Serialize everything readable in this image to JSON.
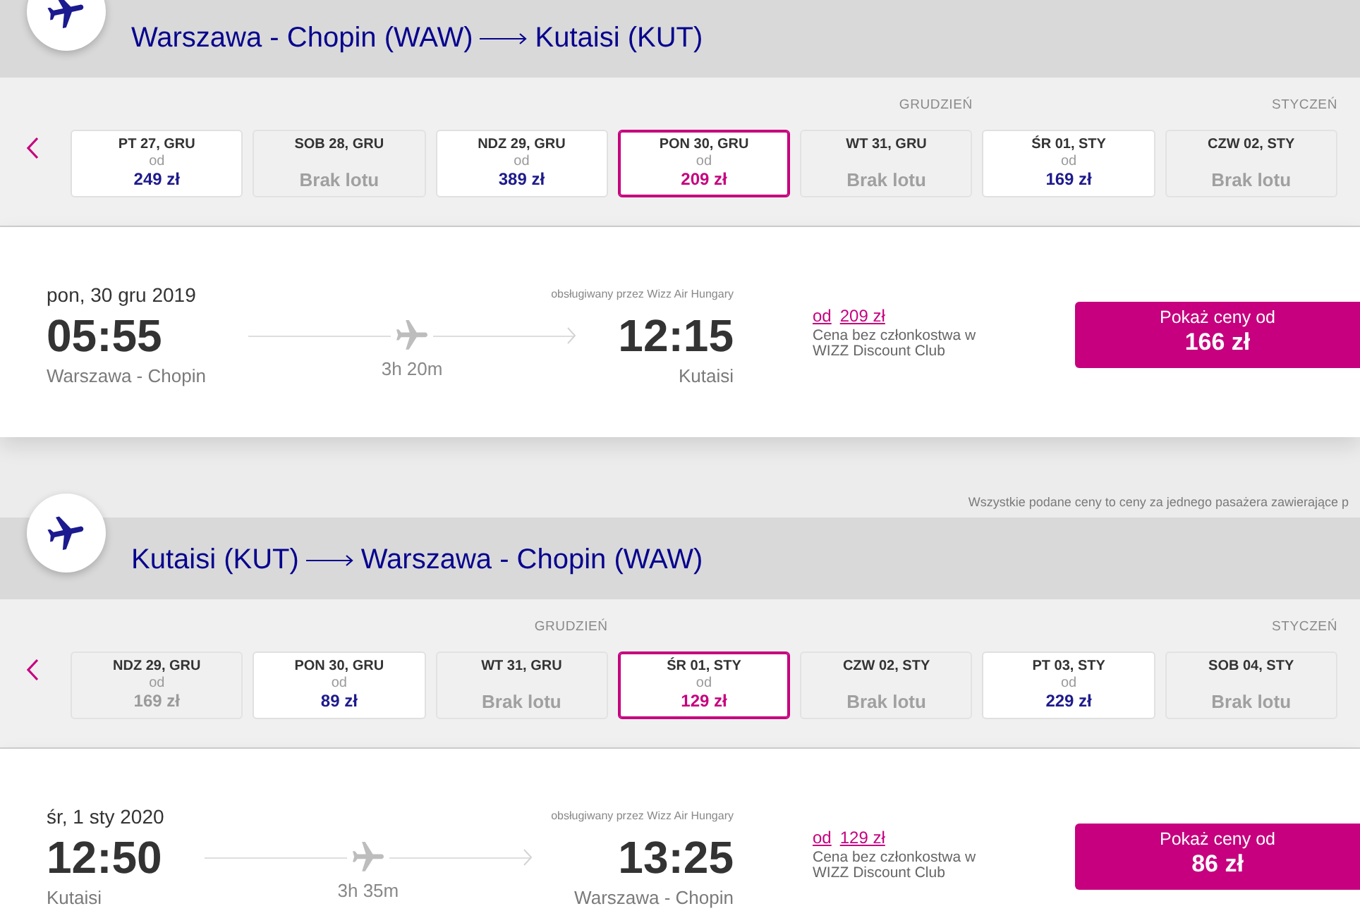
{
  "sections": [
    {
      "route": {
        "origin": "Warszawa - Chopin (WAW)",
        "destination": "Kutaisi (KUT)"
      },
      "months": [
        {
          "label": "GRUDZIEŃ",
          "days": [
            {
              "date": "PT 27, GRU",
              "from": "od",
              "price": "249 zł",
              "available": true,
              "selected": false
            },
            {
              "date": "SOB 28, GRU",
              "price": "Brak lotu",
              "available": false,
              "selected": false
            },
            {
              "date": "NDZ 29, GRU",
              "from": "od",
              "price": "389 zł",
              "available": true,
              "selected": false
            },
            {
              "date": "PON 30, GRU",
              "from": "od",
              "price": "209 zł",
              "available": true,
              "selected": true
            },
            {
              "date": "WT 31, GRU",
              "price": "Brak lotu",
              "available": false,
              "selected": false
            }
          ]
        },
        {
          "label": "STYCZEŃ",
          "days": [
            {
              "date": "ŚR 01, STY",
              "from": "od",
              "price": "169 zł",
              "available": true,
              "selected": false
            },
            {
              "date": "CZW 02, STY",
              "price": "Brak lotu",
              "available": false,
              "selected": false
            }
          ]
        }
      ],
      "flight": {
        "date": "pon, 30 gru 2019",
        "departure_time": "05:55",
        "departure_airport": "Warszawa - Chopin",
        "duration": "3h 20m",
        "operator": "obsługiwany przez Wizz Air Hungary",
        "arrival_time": "12:15",
        "arrival_airport": "Kutaisi",
        "regular_price": {
          "prefix": "od",
          "price": "209 zł"
        },
        "price_note": "Cena bez członkostwa w WIZZ Discount Club",
        "button": {
          "label": "Pokaż ceny od",
          "price": "166 zł"
        }
      }
    },
    {
      "notice": "Wszystkie podane ceny to ceny za jednego pasażera zawierające p",
      "route": {
        "origin": "Kutaisi (KUT)",
        "destination": "Warszawa - Chopin (WAW)"
      },
      "months": [
        {
          "label": "GRUDZIEŃ",
          "days": [
            {
              "date": "NDZ 29, GRU",
              "from": "od",
              "price": "169 zł",
              "available": false,
              "selected": false
            },
            {
              "date": "PON 30, GRU",
              "from": "od",
              "price": "89 zł",
              "available": true,
              "selected": false
            },
            {
              "date": "WT 31, GRU",
              "price": "Brak lotu",
              "available": false,
              "selected": false
            }
          ]
        },
        {
          "label": "STYCZEŃ",
          "days": [
            {
              "date": "ŚR 01, STY",
              "from": "od",
              "price": "129 zł",
              "available": true,
              "selected": true
            },
            {
              "date": "CZW 02, STY",
              "price": "Brak lotu",
              "available": false,
              "selected": false
            },
            {
              "date": "PT 03, STY",
              "from": "od",
              "price": "229 zł",
              "available": true,
              "selected": false
            },
            {
              "date": "SOB 04, STY",
              "price": "Brak lotu",
              "available": false,
              "selected": false
            }
          ]
        }
      ],
      "flight": {
        "date": "śr, 1 sty 2020",
        "departure_time": "12:50",
        "departure_airport": "Kutaisi",
        "duration": "3h 35m",
        "operator": "obsługiwany przez Wizz Air Hungary",
        "arrival_time": "13:25",
        "arrival_airport": "Warszawa - Chopin",
        "regular_price": {
          "prefix": "od",
          "price": "129 zł"
        },
        "price_note": "Cena bez członkostwa w WIZZ Discount Club",
        "button": {
          "label": "Pokaż ceny od",
          "price": "86 zł"
        }
      }
    }
  ]
}
